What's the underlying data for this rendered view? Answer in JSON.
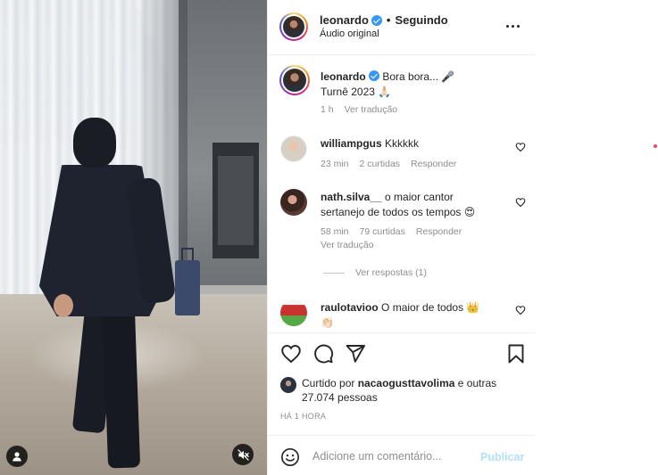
{
  "post": {
    "username": "leonardo",
    "follow_state": "Seguindo",
    "separator": "•",
    "audio": "Áudio original",
    "caption_line1": "Bora bora... 🎤",
    "caption_line2": "Turnê 2023 🙏🏻",
    "caption_time": "1 h",
    "translate_label": "Ver tradução"
  },
  "comments": [
    {
      "username": "williampgus",
      "text": "Kkkkkk",
      "time": "23 min",
      "likes": "2 curtidas",
      "reply_label": "Responder"
    },
    {
      "username": "nath.silva__",
      "text_line1": "o maior cantor",
      "text_line2": "sertanejo de todos os tempos 😍",
      "time": "58 min",
      "likes": "79 curtidas",
      "reply_label": "Responder",
      "translate_label": "Ver tradução",
      "view_replies": "Ver respostas (1)"
    },
    {
      "username": "raulotavioo",
      "text": "O maior de todos 👑",
      "text_line2": "👏🏻"
    }
  ],
  "likes": {
    "prefix": "Curtido por",
    "user": "nacaogusttavolima",
    "suffix_joiner": "e",
    "others": "outras 27.074 pessoas"
  },
  "timestamp": "HÁ 1 HORA",
  "add_comment": {
    "placeholder": "Adicione um comentário...",
    "publish_label": "Publicar"
  },
  "colors": {
    "verified": "#3897f0",
    "publish_disabled": "#b2dffc",
    "muted_text": "#8e8e8e",
    "text": "#262626"
  },
  "icons": [
    "user-tag-icon",
    "muted-speaker-icon",
    "verified-badge-icon",
    "more-options-icon",
    "heart-icon",
    "comment-icon",
    "share-icon",
    "bookmark-icon",
    "emoji-icon"
  ]
}
